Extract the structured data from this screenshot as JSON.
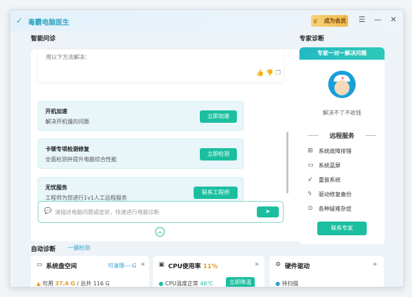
{
  "app": {
    "title": "毒霸电脑医生",
    "vip_label": "成为会员",
    "vip_badge": "VIP"
  },
  "titlebar_icons": [
    "menu-icon",
    "minimize-icon",
    "close-icon"
  ],
  "sections": {
    "smart_consult": "智能问诊",
    "expert_diag": "专家诊断"
  },
  "chat": {
    "partial_text": "用以下方法解决：",
    "feedback_icons": [
      "thumbs-up-icon",
      "thumbs-down-icon",
      "copy-icon"
    ]
  },
  "services": [
    {
      "title": "开机加速",
      "desc": "解决开机慢的问题",
      "button": "立即加速"
    },
    {
      "title": "卡顿专项检测修复",
      "desc": "全面检测并提升电脑综合性能",
      "button": "立即检测"
    },
    {
      "title": "无忧服务",
      "desc": "工程师为您进行1v1人工远程服务",
      "button": "联系工程师"
    }
  ],
  "input": {
    "placeholder": "请描述电脑问题或症状，快速进行电脑诊断",
    "send_icon": "send-icon"
  },
  "expert": {
    "header": "专家一对一解决问题",
    "subtitle": "解决不了不收钱",
    "remote_title": "远程服务",
    "items": [
      {
        "icon": "grid-icon",
        "label": "系统故障排错"
      },
      {
        "icon": "monitor-icon",
        "label": "系统蓝屏"
      },
      {
        "icon": "rocket-icon",
        "label": "重装系统"
      },
      {
        "icon": "bolt-icon",
        "label": "驱动修复备份"
      },
      {
        "icon": "more-icon",
        "label": "各种疑难杂症"
      }
    ],
    "button": "联系专家"
  },
  "auto_diag": {
    "title": "自动诊断",
    "link": "一键检测"
  },
  "bottom_cards": [
    {
      "title": "系统盘空间",
      "extra": "可清理----G",
      "line_prefix": "可用",
      "line_value": "37.4 G",
      "line_suffix": "/ 总共 116 G"
    },
    {
      "title": "CPU使用率",
      "title_value": "11%",
      "line_prefix": "CPU温度正常",
      "line_value": "46℃",
      "button": "立即降温"
    },
    {
      "title": "硬件驱动",
      "line_prefix": "待扫描"
    }
  ],
  "colors": {
    "accent": "#1bbfa0",
    "brand": "#2fa6c0",
    "link": "#2da0d0",
    "warning": "#f0a020"
  }
}
